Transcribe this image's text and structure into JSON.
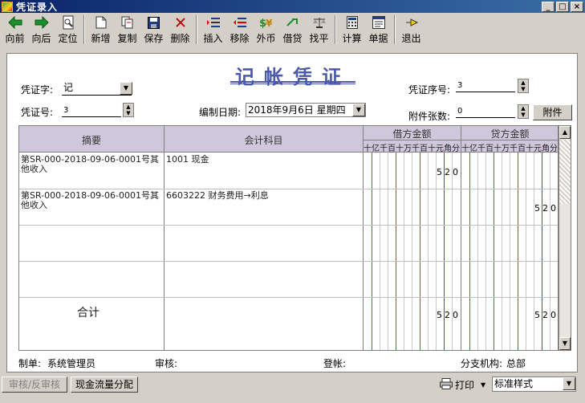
{
  "window": {
    "title": "凭证录入"
  },
  "toolbar": {
    "items": [
      {
        "label": "向前",
        "icon": "arrow-left-icon"
      },
      {
        "label": "向后",
        "icon": "arrow-right-icon"
      },
      {
        "label": "定位",
        "icon": "locate-icon"
      },
      {
        "label": "新增",
        "icon": "new-doc-icon"
      },
      {
        "label": "复制",
        "icon": "copy-icon"
      },
      {
        "label": "保存",
        "icon": "save-icon"
      },
      {
        "label": "删除",
        "icon": "delete-icon"
      },
      {
        "label": "插入",
        "icon": "insert-row-icon"
      },
      {
        "label": "移除",
        "icon": "remove-row-icon"
      },
      {
        "label": "外币",
        "icon": "currency-icon"
      },
      {
        "label": "借贷",
        "icon": "debit-credit-icon"
      },
      {
        "label": "找平",
        "icon": "balance-icon"
      },
      {
        "label": "计算",
        "icon": "calculator-icon"
      },
      {
        "label": "单据",
        "icon": "receipt-icon"
      },
      {
        "label": "退出",
        "icon": "exit-icon"
      }
    ]
  },
  "voucher": {
    "title": "记帐凭证",
    "type_label": "凭证字:",
    "type_value": "记",
    "number_label": "凭证号:",
    "number_value": "3",
    "date_label": "编制日期:",
    "date_value": "2018年9月6日  星期四",
    "seq_label": "凭证序号:",
    "seq_value": "3",
    "attach_label": "附件张数:",
    "attach_value": "0",
    "attach_button": "附件"
  },
  "grid": {
    "headers": {
      "summary": "摘要",
      "account": "会计科目",
      "debit": "借方金额",
      "credit": "贷方金额"
    },
    "digit_labels": [
      "十",
      "亿",
      "千",
      "百",
      "十",
      "万",
      "千",
      "百",
      "十",
      "元",
      "角",
      "分"
    ],
    "rows": [
      {
        "summary": "第SR-000-2018-09-06-0001号其他收入",
        "account": "1001 现金",
        "debit": "520",
        "credit": ""
      },
      {
        "summary": "第SR-000-2018-09-06-0001号其他收入",
        "account": "6603222 财务费用→利息",
        "debit": "",
        "credit": "520"
      },
      {
        "summary": "",
        "account": "",
        "debit": "",
        "credit": ""
      },
      {
        "summary": "",
        "account": "",
        "debit": "",
        "credit": ""
      }
    ],
    "total_label": "合计",
    "total_debit": "520",
    "total_credit": "520"
  },
  "footer": {
    "maker_label": "制单:",
    "maker_value": "系统管理员",
    "auditor_label": "审核:",
    "auditor_value": "",
    "poster_label": "登帐:",
    "poster_value": "",
    "branch_label": "分支机构:",
    "branch_value": "总部"
  },
  "bottom": {
    "audit_button": "审核/反审核",
    "cashflow_button": "现金流量分配",
    "print_label": "打印",
    "style_select": "标准样式"
  },
  "colors": {
    "title_blue": "#4a5aa8",
    "header_bg": "#cfc8dc",
    "green_line": "#2e8b3a",
    "red_line": "#d62020"
  }
}
